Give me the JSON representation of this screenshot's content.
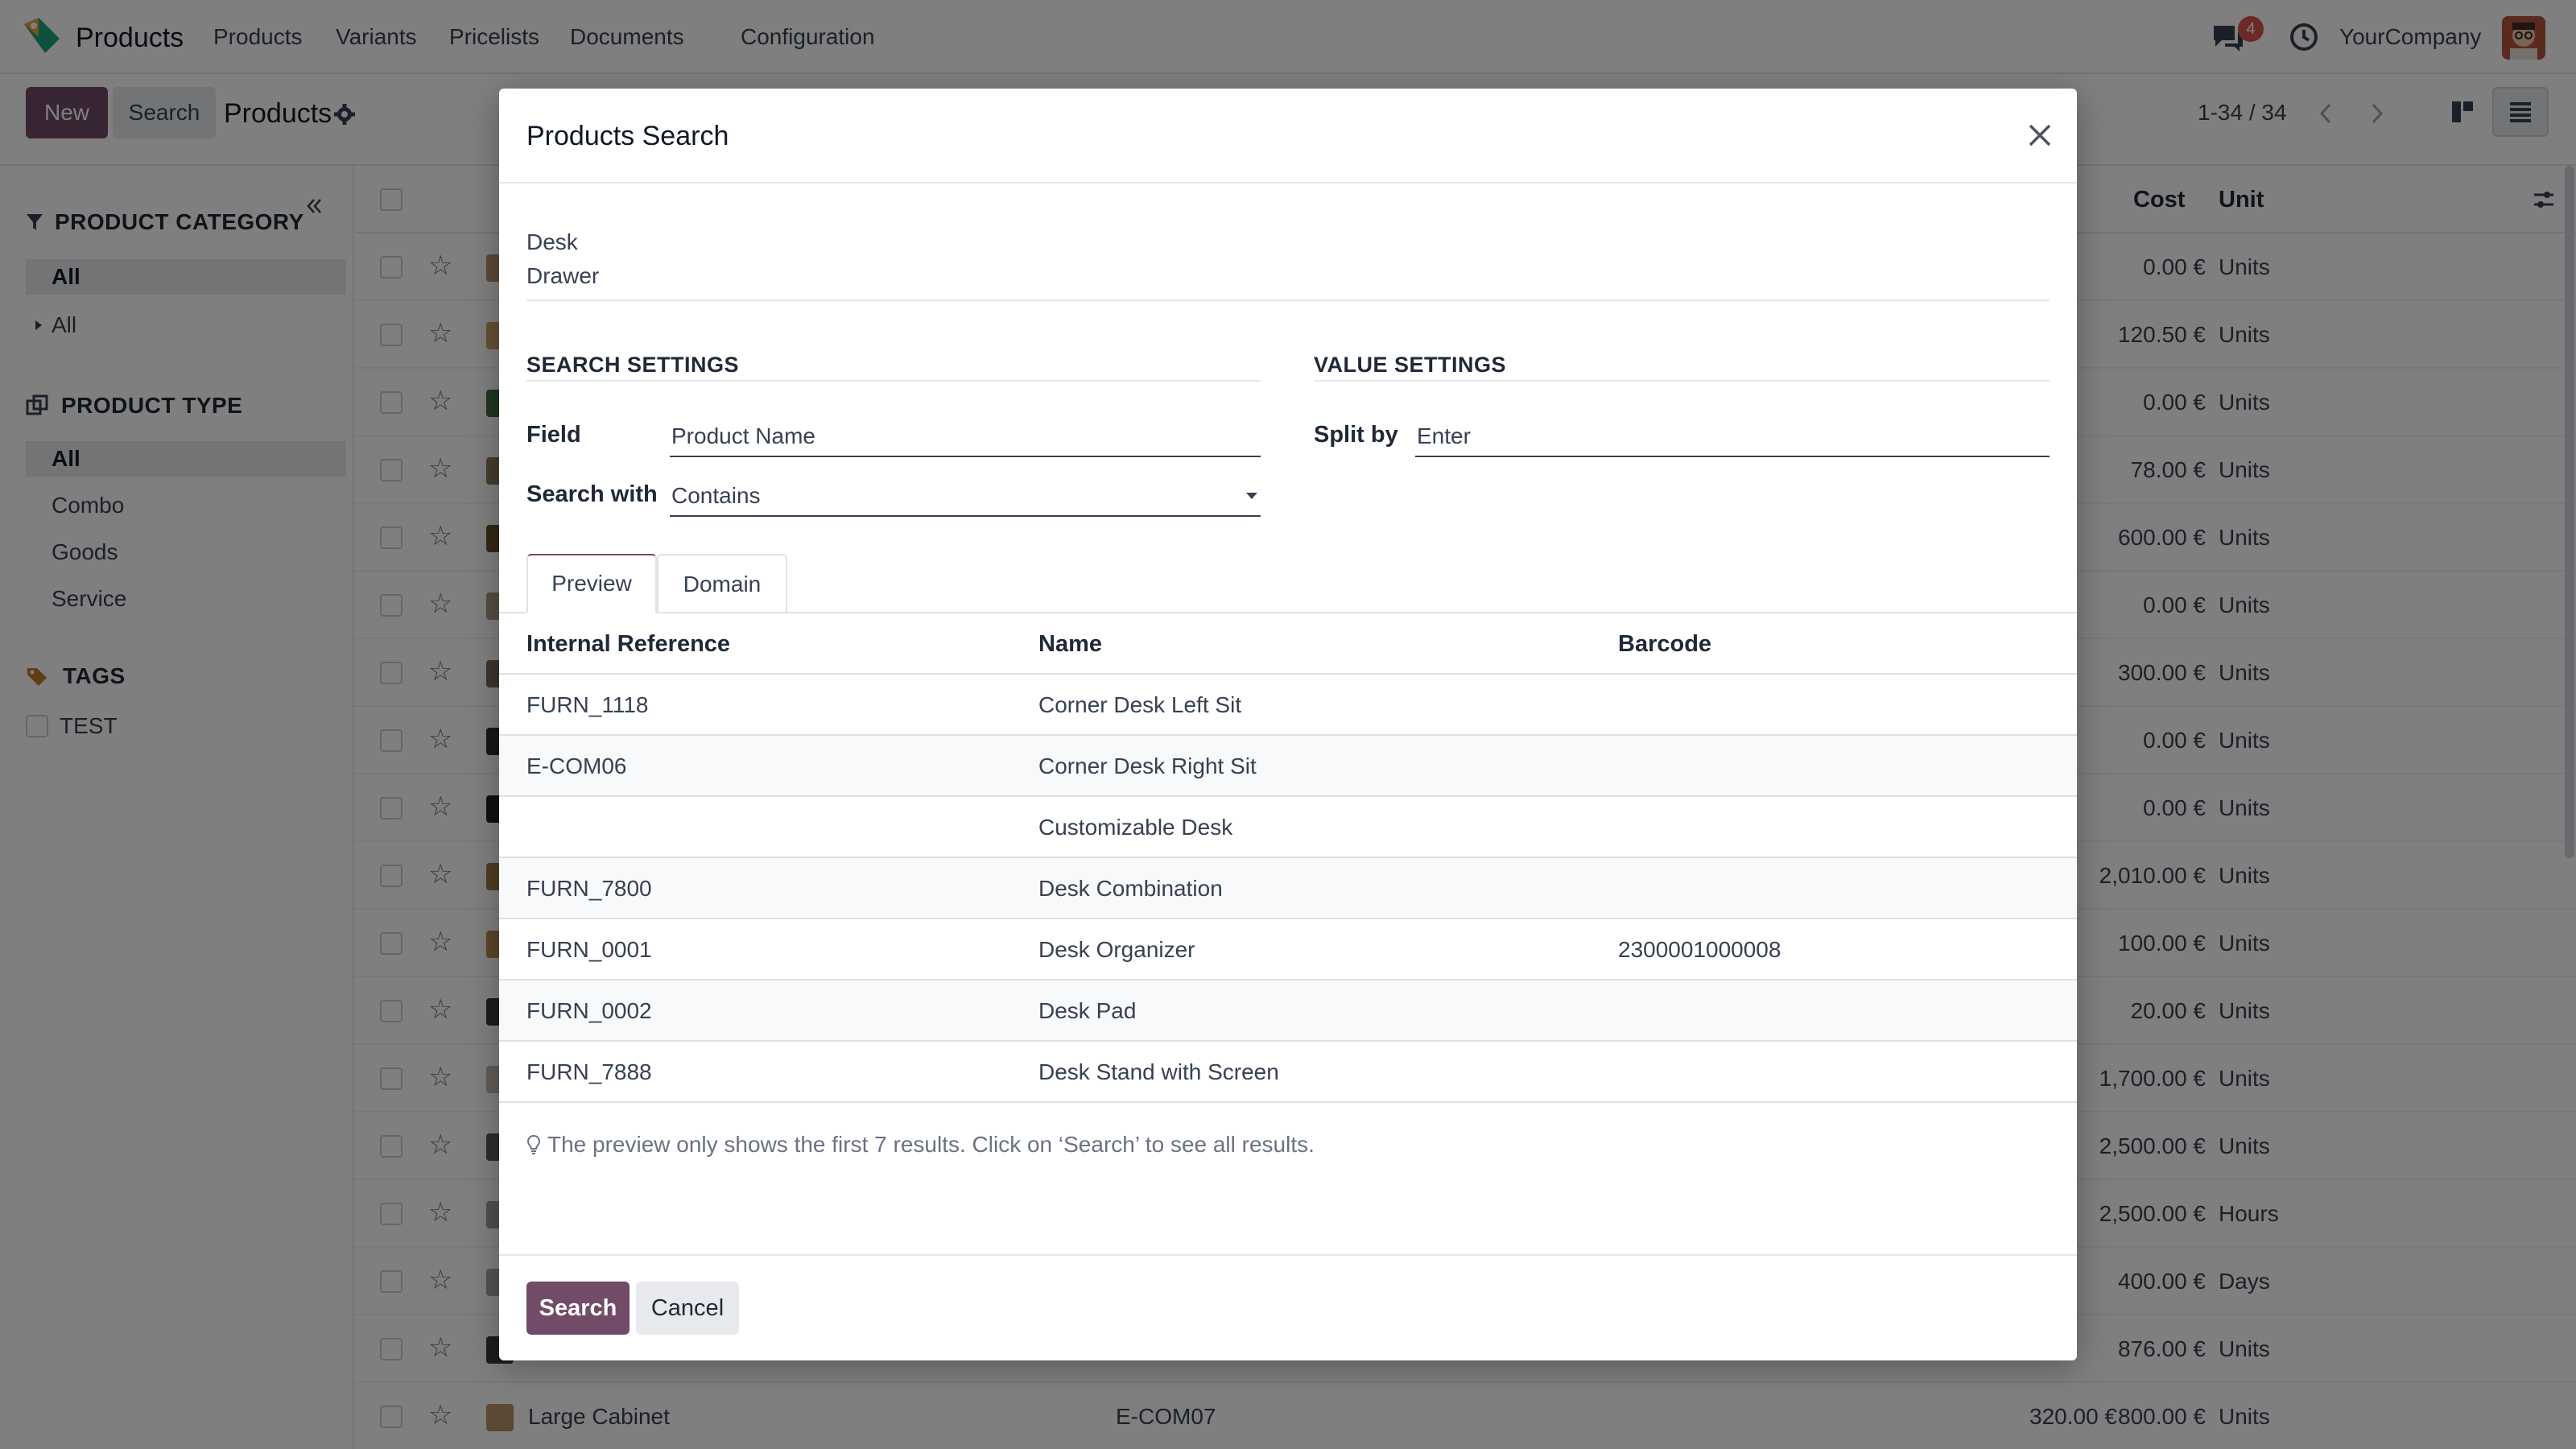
{
  "topbar": {
    "app_name": "Products",
    "menu": [
      "Products",
      "Variants",
      "Pricelists",
      "Documents",
      "Configuration"
    ],
    "chat_badge": "4",
    "company": "YourCompany"
  },
  "control_panel": {
    "new_label": "New",
    "search_label": "Search",
    "title": "Products",
    "pager": "1-34 / 34"
  },
  "sidebar": {
    "category_title": "PRODUCT CATEGORY",
    "category_items": [
      "All",
      "All"
    ],
    "type_title": "PRODUCT TYPE",
    "type_items": [
      "All",
      "Combo",
      "Goods",
      "Service"
    ],
    "tags_title": "TAGS",
    "tags_items": [
      "TEST"
    ]
  },
  "list": {
    "headers": {
      "cost": "Cost",
      "unit": "Unit"
    },
    "rows": [
      {
        "cost": "0.00 €",
        "unit": "Units"
      },
      {
        "cost": "120.50 €",
        "unit": "Units"
      },
      {
        "cost": "0.00 €",
        "unit": "Units"
      },
      {
        "cost": "78.00 €",
        "unit": "Units"
      },
      {
        "cost": "600.00 €",
        "unit": "Units"
      },
      {
        "cost": "0.00 €",
        "unit": "Units"
      },
      {
        "cost": "300.00 €",
        "unit": "Units"
      },
      {
        "cost": "0.00 €",
        "unit": "Units"
      },
      {
        "cost": "0.00 €",
        "unit": "Units"
      },
      {
        "cost": "2,010.00 €",
        "unit": "Units"
      },
      {
        "cost": "100.00 €",
        "unit": "Units"
      },
      {
        "cost": "20.00 €",
        "unit": "Units"
      },
      {
        "cost": "1,700.00 €",
        "unit": "Units"
      },
      {
        "cost": "2,500.00 €",
        "unit": "Units"
      },
      {
        "cost": "2,500.00 €",
        "unit": "Hours"
      },
      {
        "cost": "400.00 €",
        "unit": "Days"
      },
      {
        "cost": "876.00 €",
        "unit": "Units"
      }
    ],
    "last_row": {
      "name": "Large Cabinet",
      "ref": "E-COM07",
      "price": "320.00 €",
      "cost": "800.00 €",
      "unit": "Units"
    }
  },
  "modal": {
    "title": "Products Search",
    "terms": [
      "Desk",
      "Drawer"
    ],
    "search_settings_title": "SEARCH SETTINGS",
    "value_settings_title": "VALUE SETTINGS",
    "field_label": "Field",
    "field_value": "Product Name",
    "search_with_label": "Search with",
    "search_with_value": "Contains",
    "split_by_label": "Split by",
    "split_by_value": "Enter",
    "tabs": [
      "Preview",
      "Domain"
    ],
    "preview_headers": [
      "Internal Reference",
      "Name",
      "Barcode"
    ],
    "preview_rows": [
      {
        "ref": "FURN_1118",
        "name": "Corner Desk Left Sit",
        "barcode": ""
      },
      {
        "ref": "E-COM06",
        "name": "Corner Desk Right Sit",
        "barcode": ""
      },
      {
        "ref": "",
        "name": "Customizable Desk",
        "barcode": ""
      },
      {
        "ref": "FURN_7800",
        "name": "Desk Combination",
        "barcode": ""
      },
      {
        "ref": "FURN_0001",
        "name": "Desk Organizer",
        "barcode": "2300001000008"
      },
      {
        "ref": "FURN_0002",
        "name": "Desk Pad",
        "barcode": ""
      },
      {
        "ref": "FURN_7888",
        "name": "Desk Stand with Screen",
        "barcode": ""
      }
    ],
    "hint": "The preview only shows the first 7 results. Click on ‘Search’ to see all results.",
    "search_button": "Search",
    "cancel_button": "Cancel"
  },
  "colors": {
    "brand": "#714b67",
    "overlay": "rgba(0,0,0,0.5)"
  }
}
